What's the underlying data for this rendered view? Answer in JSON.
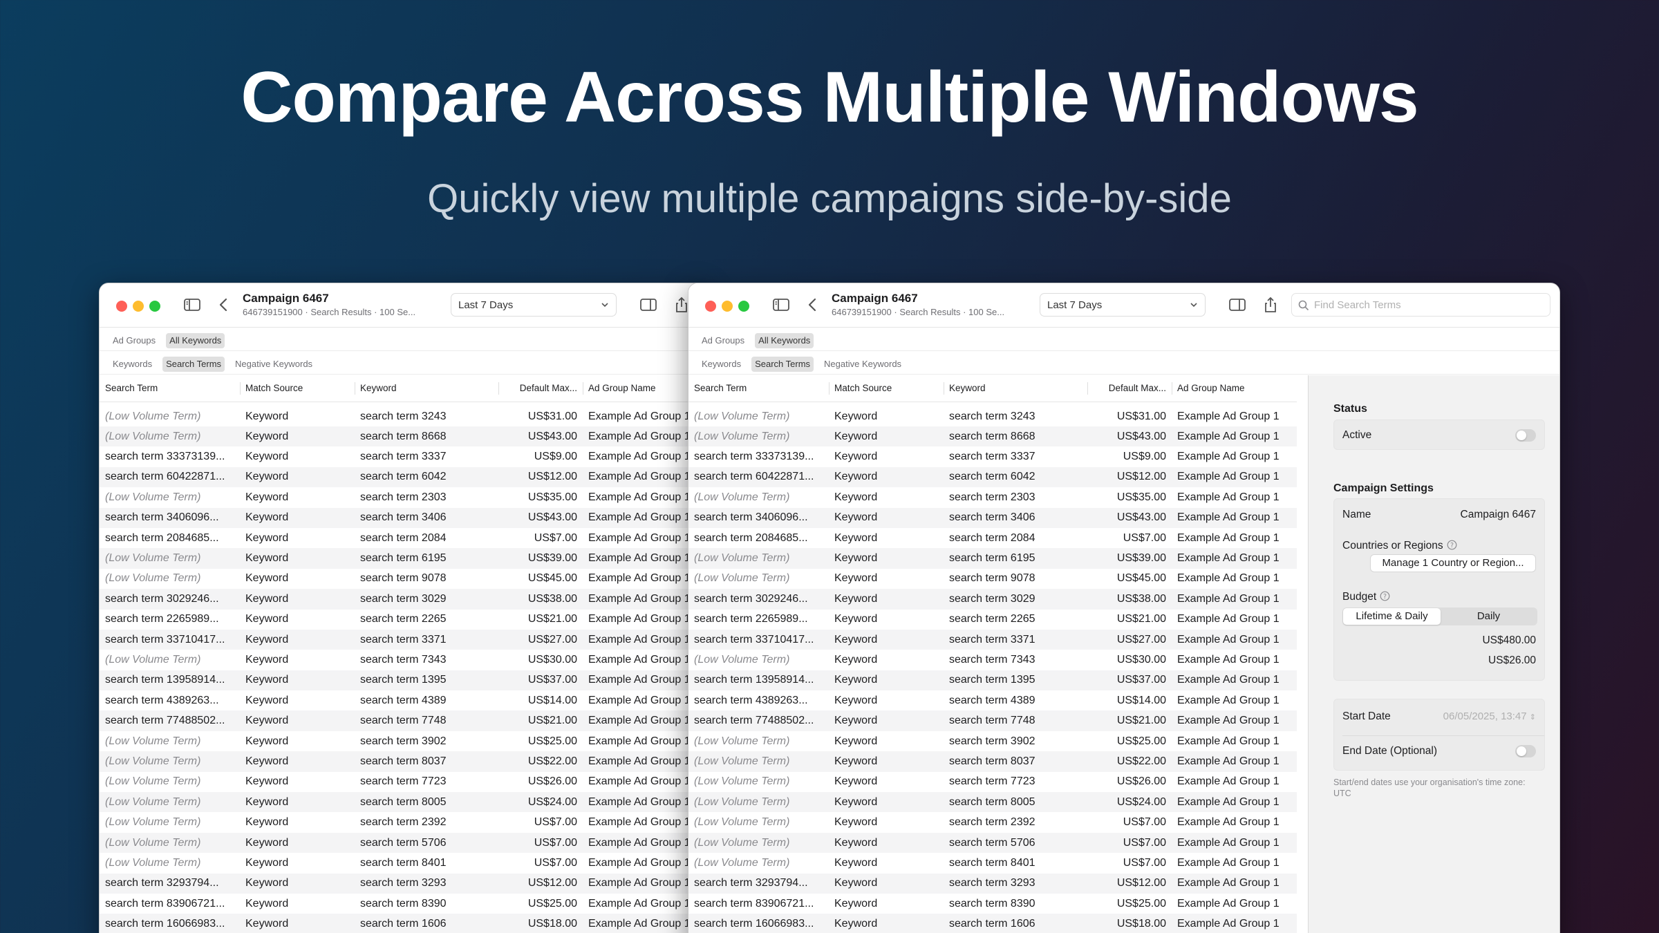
{
  "hero": {
    "title": "Compare Across Multiple Windows",
    "subtitle": "Quickly view multiple campaigns side-by-side"
  },
  "window": {
    "title": "Campaign 6467",
    "subtitle": "646739151900 · Search Results · 100 Se...",
    "date_range": "Last 7 Days",
    "search_placeholder": "Find Search Terms",
    "scope_row1": [
      {
        "label": "Ad Groups",
        "active": false
      },
      {
        "label": "All Keywords",
        "active": true
      }
    ],
    "scope_row2": [
      {
        "label": "Keywords",
        "active": false
      },
      {
        "label": "Search Terms",
        "active": true
      },
      {
        "label": "Negative Keywords",
        "active": false
      }
    ]
  },
  "table": {
    "columns": [
      "Search Term",
      "Match Source",
      "Keyword",
      "Default Max...",
      "Ad Group Name"
    ],
    "rows": [
      {
        "term": "(Low Volume Term)",
        "low": true,
        "source": "Keyword",
        "keyword": "search term 3243",
        "bid": "US$31.00",
        "group": "Example Ad Group 1"
      },
      {
        "term": "(Low Volume Term)",
        "low": true,
        "source": "Keyword",
        "keyword": "search term 8668",
        "bid": "US$43.00",
        "group": "Example Ad Group 1"
      },
      {
        "term": "search term 33373139...",
        "low": false,
        "source": "Keyword",
        "keyword": "search term 3337",
        "bid": "US$9.00",
        "group": "Example Ad Group 1"
      },
      {
        "term": "search term 60422871...",
        "low": false,
        "source": "Keyword",
        "keyword": "search term 6042",
        "bid": "US$12.00",
        "group": "Example Ad Group 1"
      },
      {
        "term": "(Low Volume Term)",
        "low": true,
        "source": "Keyword",
        "keyword": "search term 2303",
        "bid": "US$35.00",
        "group": "Example Ad Group 1"
      },
      {
        "term": "search term 3406096...",
        "low": false,
        "source": "Keyword",
        "keyword": "search term 3406",
        "bid": "US$43.00",
        "group": "Example Ad Group 1"
      },
      {
        "term": "search term 2084685...",
        "low": false,
        "source": "Keyword",
        "keyword": "search term 2084",
        "bid": "US$7.00",
        "group": "Example Ad Group 1"
      },
      {
        "term": "(Low Volume Term)",
        "low": true,
        "source": "Keyword",
        "keyword": "search term 6195",
        "bid": "US$39.00",
        "group": "Example Ad Group 1"
      },
      {
        "term": "(Low Volume Term)",
        "low": true,
        "source": "Keyword",
        "keyword": "search term 9078",
        "bid": "US$45.00",
        "group": "Example Ad Group 1"
      },
      {
        "term": "search term 3029246...",
        "low": false,
        "source": "Keyword",
        "keyword": "search term 3029",
        "bid": "US$38.00",
        "group": "Example Ad Group 1"
      },
      {
        "term": "search term 2265989...",
        "low": false,
        "source": "Keyword",
        "keyword": "search term 2265",
        "bid": "US$21.00",
        "group": "Example Ad Group 1"
      },
      {
        "term": "search term 33710417...",
        "low": false,
        "source": "Keyword",
        "keyword": "search term 3371",
        "bid": "US$27.00",
        "group": "Example Ad Group 1"
      },
      {
        "term": "(Low Volume Term)",
        "low": true,
        "source": "Keyword",
        "keyword": "search term 7343",
        "bid": "US$30.00",
        "group": "Example Ad Group 1"
      },
      {
        "term": "search term 13958914...",
        "low": false,
        "source": "Keyword",
        "keyword": "search term 1395",
        "bid": "US$37.00",
        "group": "Example Ad Group 1"
      },
      {
        "term": "search term 4389263...",
        "low": false,
        "source": "Keyword",
        "keyword": "search term 4389",
        "bid": "US$14.00",
        "group": "Example Ad Group 1"
      },
      {
        "term": "search term 77488502...",
        "low": false,
        "source": "Keyword",
        "keyword": "search term 7748",
        "bid": "US$21.00",
        "group": "Example Ad Group 1"
      },
      {
        "term": "(Low Volume Term)",
        "low": true,
        "source": "Keyword",
        "keyword": "search term 3902",
        "bid": "US$25.00",
        "group": "Example Ad Group 1"
      },
      {
        "term": "(Low Volume Term)",
        "low": true,
        "source": "Keyword",
        "keyword": "search term 8037",
        "bid": "US$22.00",
        "group": "Example Ad Group 1"
      },
      {
        "term": "(Low Volume Term)",
        "low": true,
        "source": "Keyword",
        "keyword": "search term 7723",
        "bid": "US$26.00",
        "group": "Example Ad Group 1"
      },
      {
        "term": "(Low Volume Term)",
        "low": true,
        "source": "Keyword",
        "keyword": "search term 8005",
        "bid": "US$24.00",
        "group": "Example Ad Group 1"
      },
      {
        "term": "(Low Volume Term)",
        "low": true,
        "source": "Keyword",
        "keyword": "search term 2392",
        "bid": "US$7.00",
        "group": "Example Ad Group 1"
      },
      {
        "term": "(Low Volume Term)",
        "low": true,
        "source": "Keyword",
        "keyword": "search term 5706",
        "bid": "US$7.00",
        "group": "Example Ad Group 1"
      },
      {
        "term": "(Low Volume Term)",
        "low": true,
        "source": "Keyword",
        "keyword": "search term 8401",
        "bid": "US$7.00",
        "group": "Example Ad Group 1"
      },
      {
        "term": "search term 3293794...",
        "low": false,
        "source": "Keyword",
        "keyword": "search term 3293",
        "bid": "US$12.00",
        "group": "Example Ad Group 1"
      },
      {
        "term": "search term 83906721...",
        "low": false,
        "source": "Keyword",
        "keyword": "search term 8390",
        "bid": "US$25.00",
        "group": "Example Ad Group 1"
      },
      {
        "term": "search term 16066983...",
        "low": false,
        "source": "Keyword",
        "keyword": "search term 1606",
        "bid": "US$18.00",
        "group": "Example Ad Group 1"
      }
    ]
  },
  "inspector": {
    "status_title": "Status",
    "active_label": "Active",
    "settings_title": "Campaign Settings",
    "name_label": "Name",
    "name_value": "Campaign 6467",
    "countries_label": "Countries or Regions",
    "manage_button": "Manage 1 Country or Region...",
    "budget_label": "Budget",
    "budget_tab_lifetime": "Lifetime & Daily",
    "budget_tab_daily": "Daily",
    "lifetime_budget": "US$480.00",
    "daily_budget": "US$26.00",
    "start_date_label": "Start Date",
    "start_date_value": "06/05/2025, 13:47",
    "end_date_label": "End Date (Optional)",
    "footnote": "Start/end dates use your organisation's time zone: UTC"
  }
}
